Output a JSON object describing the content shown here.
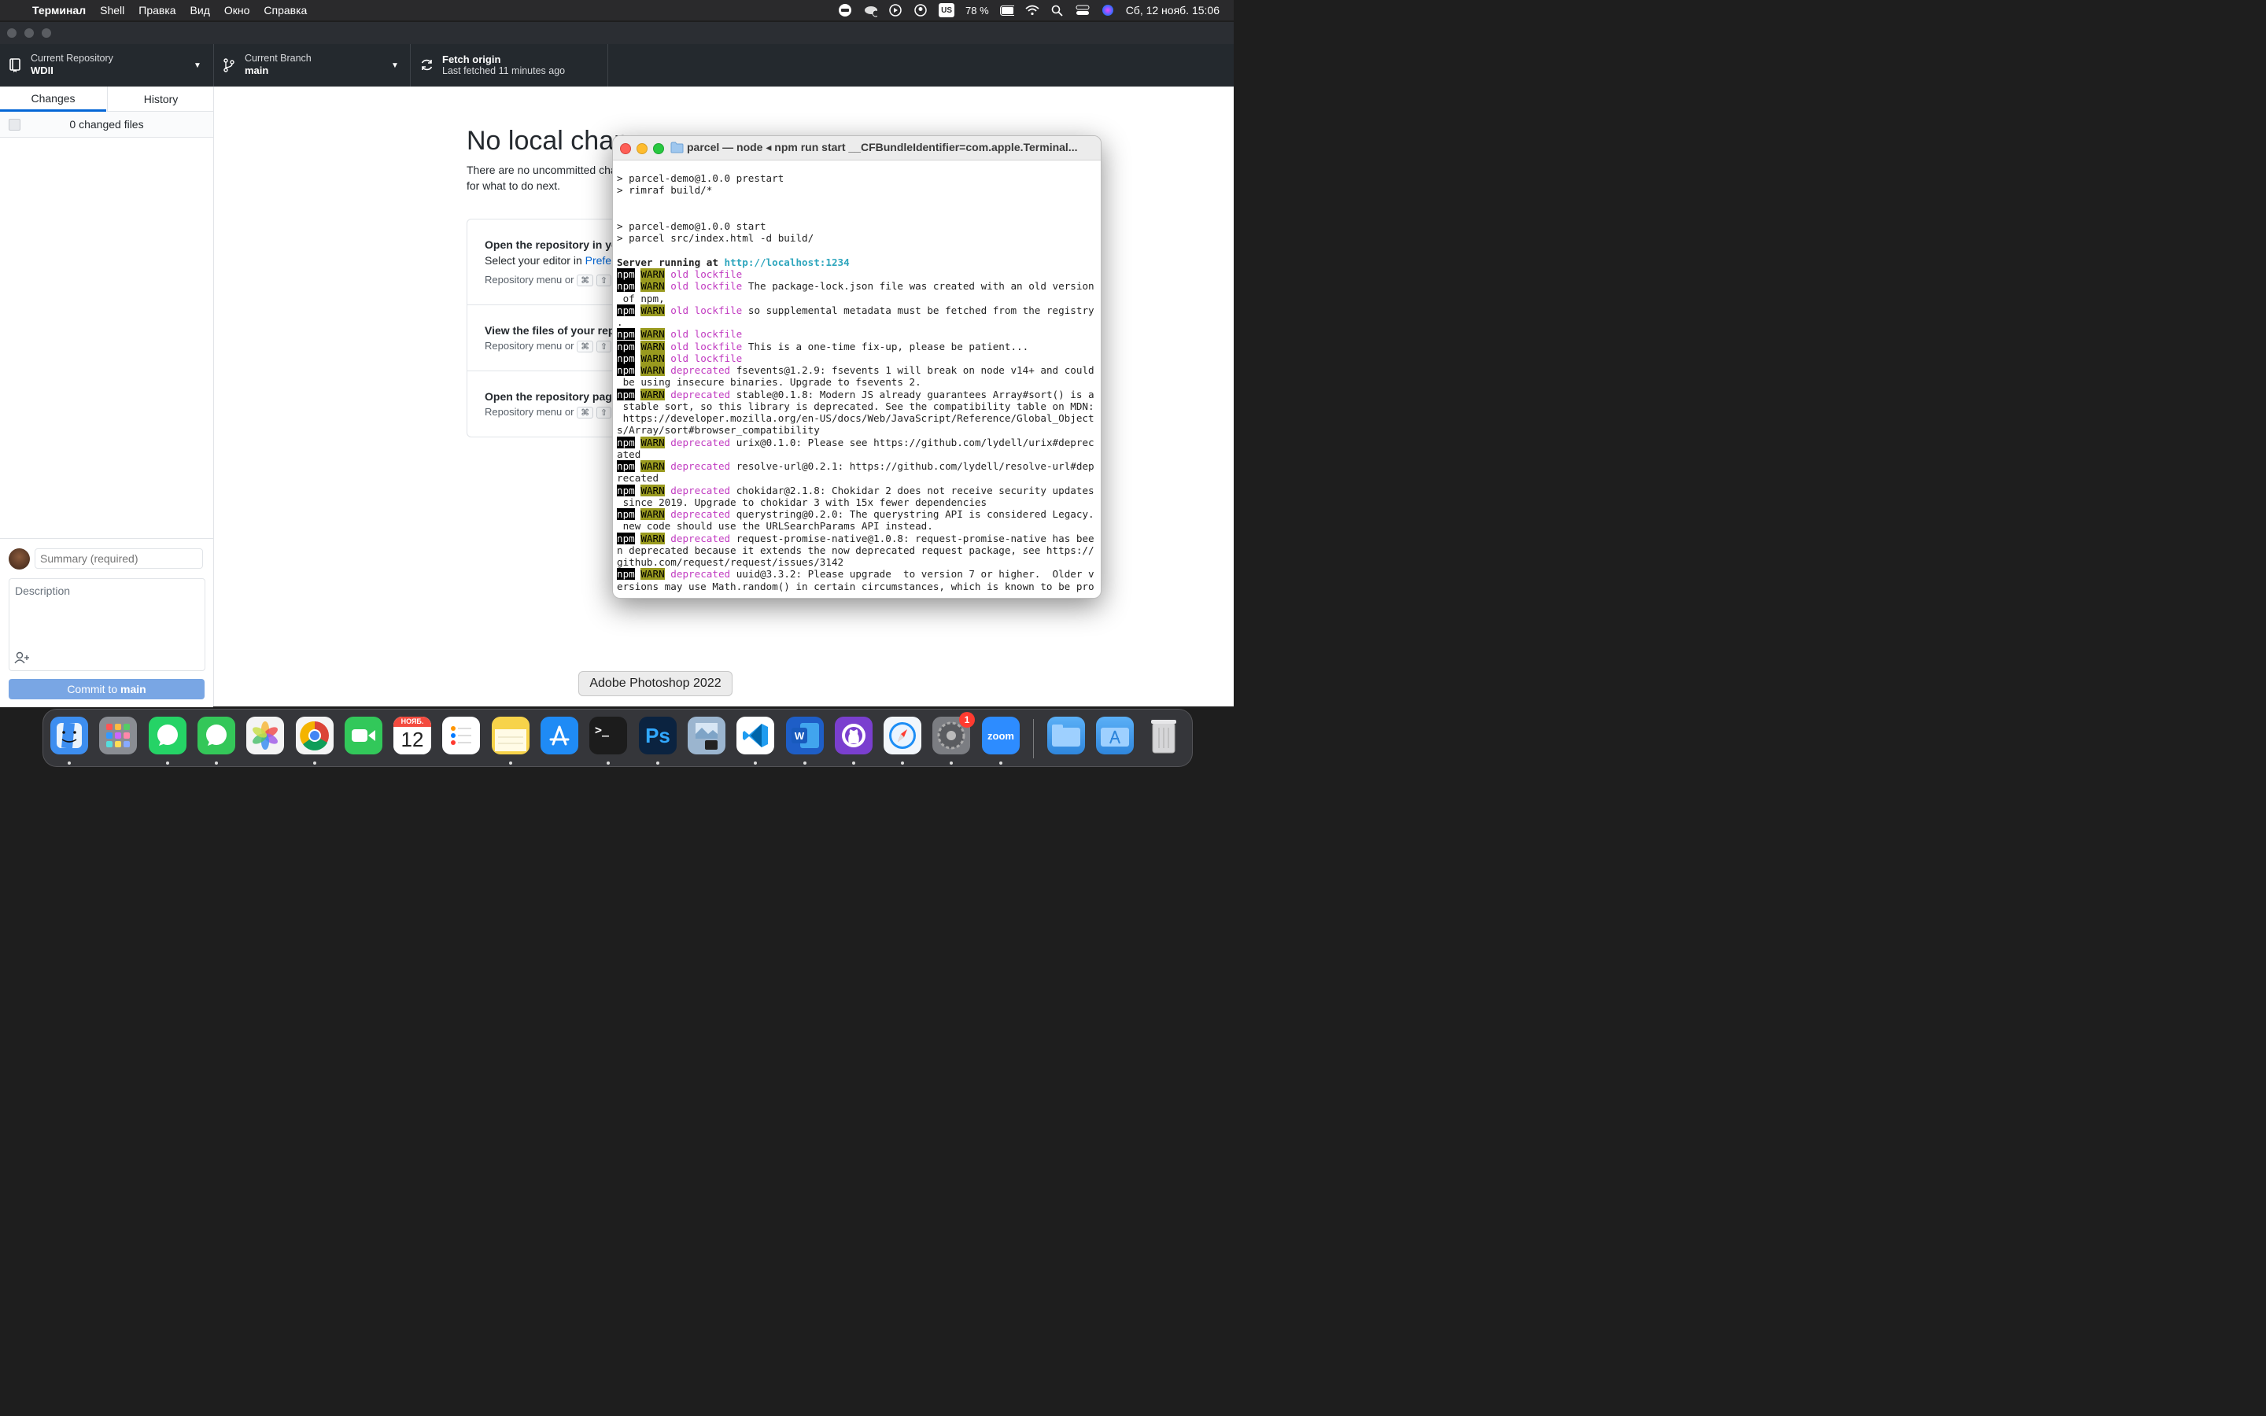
{
  "menubar": {
    "app_name": "Терминал",
    "items": [
      "Shell",
      "Правка",
      "Вид",
      "Окно",
      "Справка"
    ],
    "battery": "78 %",
    "keyboard_layout": "US",
    "datetime": "Сб, 12 нояб. 15:06"
  },
  "toolbar": {
    "repo_label": "Current Repository",
    "repo_value": "WDII",
    "branch_label": "Current Branch",
    "branch_value": "main",
    "fetch_label": "Fetch origin",
    "fetch_sub": "Last fetched 11 minutes ago"
  },
  "sidebar": {
    "tabs": [
      "Changes",
      "History"
    ],
    "changed_files": "0 changed files",
    "summary_placeholder": "Summary (required)",
    "description_placeholder": "Description",
    "commit_prefix": "Commit to ",
    "commit_branch": "main"
  },
  "main": {
    "heading": "No local chan",
    "text_line1": "There are no uncommitted cha",
    "text_line2": "for what to do next.",
    "cards": [
      {
        "title": "Open the repository in yo",
        "line": "Select your editor in ",
        "link": "Prefe",
        "hint": "Repository menu or"
      },
      {
        "title": "View the files of your repo",
        "hint": "Repository menu or"
      },
      {
        "title": "Open the repository page",
        "hint": "Repository menu or"
      }
    ]
  },
  "terminal": {
    "title": "parcel — node ◂ npm run start __CFBundleIdentifier=com.apple.Terminal...",
    "lines": [
      {
        "segments": [
          {
            "t": "> parcel-demo@1.0.0 prestart",
            "c": ""
          }
        ]
      },
      {
        "segments": [
          {
            "t": "> rimraf build/*",
            "c": ""
          }
        ]
      },
      {
        "segments": [
          {
            "t": "",
            "c": ""
          }
        ]
      },
      {
        "segments": [
          {
            "t": "",
            "c": ""
          }
        ]
      },
      {
        "segments": [
          {
            "t": "> parcel-demo@1.0.0 start",
            "c": ""
          }
        ]
      },
      {
        "segments": [
          {
            "t": "> parcel src/index.html -d build/",
            "c": ""
          }
        ]
      },
      {
        "segments": [
          {
            "t": "",
            "c": ""
          }
        ]
      },
      {
        "segments": [
          {
            "t": "Server running at ",
            "c": "bld"
          },
          {
            "t": "http://localhost:1234",
            "c": "cyan"
          }
        ]
      },
      {
        "segments": [
          {
            "t": "npm",
            "c": "npm"
          },
          {
            "t": " ",
            "c": ""
          },
          {
            "t": "WARN",
            "c": "warn"
          },
          {
            "t": " ",
            "c": ""
          },
          {
            "t": "old lockfile",
            "c": "mag"
          }
        ]
      },
      {
        "segments": [
          {
            "t": "npm",
            "c": "npm"
          },
          {
            "t": " ",
            "c": ""
          },
          {
            "t": "WARN",
            "c": "warn"
          },
          {
            "t": " ",
            "c": ""
          },
          {
            "t": "old lockfile",
            "c": "mag"
          },
          {
            "t": " The package-lock.json file was created with an old version",
            "c": ""
          }
        ]
      },
      {
        "segments": [
          {
            "t": " of npm,",
            "c": ""
          }
        ]
      },
      {
        "segments": [
          {
            "t": "npm",
            "c": "npm"
          },
          {
            "t": " ",
            "c": ""
          },
          {
            "t": "WARN",
            "c": "warn"
          },
          {
            "t": " ",
            "c": ""
          },
          {
            "t": "old lockfile",
            "c": "mag"
          },
          {
            "t": " so supplemental metadata must be fetched from the registry",
            "c": ""
          }
        ]
      },
      {
        "segments": [
          {
            "t": ".",
            "c": ""
          }
        ]
      },
      {
        "segments": [
          {
            "t": "npm",
            "c": "npm"
          },
          {
            "t": " ",
            "c": ""
          },
          {
            "t": "WARN",
            "c": "warn"
          },
          {
            "t": " ",
            "c": ""
          },
          {
            "t": "old lockfile",
            "c": "mag"
          }
        ]
      },
      {
        "segments": [
          {
            "t": "npm",
            "c": "npm"
          },
          {
            "t": " ",
            "c": ""
          },
          {
            "t": "WARN",
            "c": "warn"
          },
          {
            "t": " ",
            "c": ""
          },
          {
            "t": "old lockfile",
            "c": "mag"
          },
          {
            "t": " This is a one-time fix-up, please be patient...",
            "c": ""
          }
        ]
      },
      {
        "segments": [
          {
            "t": "npm",
            "c": "npm"
          },
          {
            "t": " ",
            "c": ""
          },
          {
            "t": "WARN",
            "c": "warn"
          },
          {
            "t": " ",
            "c": ""
          },
          {
            "t": "old lockfile",
            "c": "mag"
          }
        ]
      },
      {
        "segments": [
          {
            "t": "npm",
            "c": "npm"
          },
          {
            "t": " ",
            "c": ""
          },
          {
            "t": "WARN",
            "c": "warn"
          },
          {
            "t": " ",
            "c": ""
          },
          {
            "t": "deprecated",
            "c": "mag"
          },
          {
            "t": " fsevents@1.2.9: fsevents 1 will break on node v14+ and could",
            "c": ""
          }
        ]
      },
      {
        "segments": [
          {
            "t": " be using insecure binaries. Upgrade to fsevents 2.",
            "c": ""
          }
        ]
      },
      {
        "segments": [
          {
            "t": "npm",
            "c": "npm"
          },
          {
            "t": " ",
            "c": ""
          },
          {
            "t": "WARN",
            "c": "warn"
          },
          {
            "t": " ",
            "c": ""
          },
          {
            "t": "deprecated",
            "c": "mag"
          },
          {
            "t": " stable@0.1.8: Modern JS already guarantees Array#sort() is a",
            "c": ""
          }
        ]
      },
      {
        "segments": [
          {
            "t": " stable sort, so this library is deprecated. See the compatibility table on MDN:",
            "c": ""
          }
        ]
      },
      {
        "segments": [
          {
            "t": " https://developer.mozilla.org/en-US/docs/Web/JavaScript/Reference/Global_Object",
            "c": ""
          }
        ]
      },
      {
        "segments": [
          {
            "t": "s/Array/sort#browser_compatibility",
            "c": ""
          }
        ]
      },
      {
        "segments": [
          {
            "t": "npm",
            "c": "npm"
          },
          {
            "t": " ",
            "c": ""
          },
          {
            "t": "WARN",
            "c": "warn"
          },
          {
            "t": " ",
            "c": ""
          },
          {
            "t": "deprecated",
            "c": "mag"
          },
          {
            "t": " urix@0.1.0: Please see https://github.com/lydell/urix#deprec",
            "c": ""
          }
        ]
      },
      {
        "segments": [
          {
            "t": "ated",
            "c": ""
          }
        ]
      },
      {
        "segments": [
          {
            "t": "npm",
            "c": "npm"
          },
          {
            "t": " ",
            "c": ""
          },
          {
            "t": "WARN",
            "c": "warn"
          },
          {
            "t": " ",
            "c": ""
          },
          {
            "t": "deprecated",
            "c": "mag"
          },
          {
            "t": " resolve-url@0.2.1: https://github.com/lydell/resolve-url#dep",
            "c": ""
          }
        ]
      },
      {
        "segments": [
          {
            "t": "recated",
            "c": ""
          }
        ]
      },
      {
        "segments": [
          {
            "t": "npm",
            "c": "npm"
          },
          {
            "t": " ",
            "c": ""
          },
          {
            "t": "WARN",
            "c": "warn"
          },
          {
            "t": " ",
            "c": ""
          },
          {
            "t": "deprecated",
            "c": "mag"
          },
          {
            "t": " chokidar@2.1.8: Chokidar 2 does not receive security updates",
            "c": ""
          }
        ]
      },
      {
        "segments": [
          {
            "t": " since 2019. Upgrade to chokidar 3 with 15x fewer dependencies",
            "c": ""
          }
        ]
      },
      {
        "segments": [
          {
            "t": "npm",
            "c": "npm"
          },
          {
            "t": " ",
            "c": ""
          },
          {
            "t": "WARN",
            "c": "warn"
          },
          {
            "t": " ",
            "c": ""
          },
          {
            "t": "deprecated",
            "c": "mag"
          },
          {
            "t": " querystring@0.2.0: The querystring API is considered Legacy.",
            "c": ""
          }
        ]
      },
      {
        "segments": [
          {
            "t": " new code should use the URLSearchParams API instead.",
            "c": ""
          }
        ]
      },
      {
        "segments": [
          {
            "t": "npm",
            "c": "npm"
          },
          {
            "t": " ",
            "c": ""
          },
          {
            "t": "WARN",
            "c": "warn"
          },
          {
            "t": " ",
            "c": ""
          },
          {
            "t": "deprecated",
            "c": "mag"
          },
          {
            "t": " request-promise-native@1.0.8: request-promise-native has bee",
            "c": ""
          }
        ]
      },
      {
        "segments": [
          {
            "t": "n deprecated because it extends the now deprecated request package, see https://",
            "c": ""
          }
        ]
      },
      {
        "segments": [
          {
            "t": "github.com/request/request/issues/3142",
            "c": ""
          }
        ]
      },
      {
        "segments": [
          {
            "t": "npm",
            "c": "npm"
          },
          {
            "t": " ",
            "c": ""
          },
          {
            "t": "WARN",
            "c": "warn"
          },
          {
            "t": " ",
            "c": ""
          },
          {
            "t": "deprecated",
            "c": "mag"
          },
          {
            "t": " uuid@3.3.2: Please upgrade  to version 7 or higher.  Older v",
            "c": ""
          }
        ]
      },
      {
        "segments": [
          {
            "t": "ersions may use Math.random() in certain circumstances, which is known to be pro",
            "c": ""
          }
        ]
      }
    ]
  },
  "dock": {
    "tooltip": "Adobe Photoshop 2022",
    "calendar_month": "НОЯБ.",
    "calendar_day": "12",
    "badge_settings": "1",
    "zoom_label": "zoom",
    "ps_label": "Ps",
    "apps": [
      {
        "name": "finder-icon",
        "color": "#3d8ef0",
        "running": true
      },
      {
        "name": "launchpad-icon",
        "color": "#8a8d93",
        "running": false
      },
      {
        "name": "whatsapp-icon",
        "color": "#25d366",
        "running": true
      },
      {
        "name": "messages-icon",
        "color": "#34c759",
        "running": true
      },
      {
        "name": "photos-icon",
        "color": "#f4f4f4",
        "running": false
      },
      {
        "name": "chrome-icon",
        "color": "#f4f4f4",
        "running": true
      },
      {
        "name": "facetime-icon",
        "color": "#32c85a",
        "running": false
      },
      {
        "name": "calendar-icon",
        "color": "#ffffff",
        "running": false
      },
      {
        "name": "reminders-icon",
        "color": "#ffffff",
        "running": false
      },
      {
        "name": "notes-icon",
        "color": "#f7d34a",
        "running": true
      },
      {
        "name": "app-store-icon",
        "color": "#1f8bf5",
        "running": false
      },
      {
        "name": "terminal-icon",
        "color": "#1c1c1c",
        "running": true
      },
      {
        "name": "photoshop-icon",
        "color": "#0b2340",
        "running": true
      },
      {
        "name": "preview-icon",
        "color": "#9bb5cf",
        "running": false
      },
      {
        "name": "vscode-icon",
        "color": "#ffffff",
        "running": true
      },
      {
        "name": "word-icon",
        "color": "#1e5ec7",
        "running": true
      },
      {
        "name": "github-desktop-icon",
        "color": "#7a3fcf",
        "running": true
      },
      {
        "name": "safari-icon",
        "color": "#f2f6fb",
        "running": true
      },
      {
        "name": "system-preferences-icon",
        "color": "#7b7d82",
        "running": true
      },
      {
        "name": "zoom-icon",
        "color": "#2d8cff",
        "running": true
      }
    ]
  }
}
